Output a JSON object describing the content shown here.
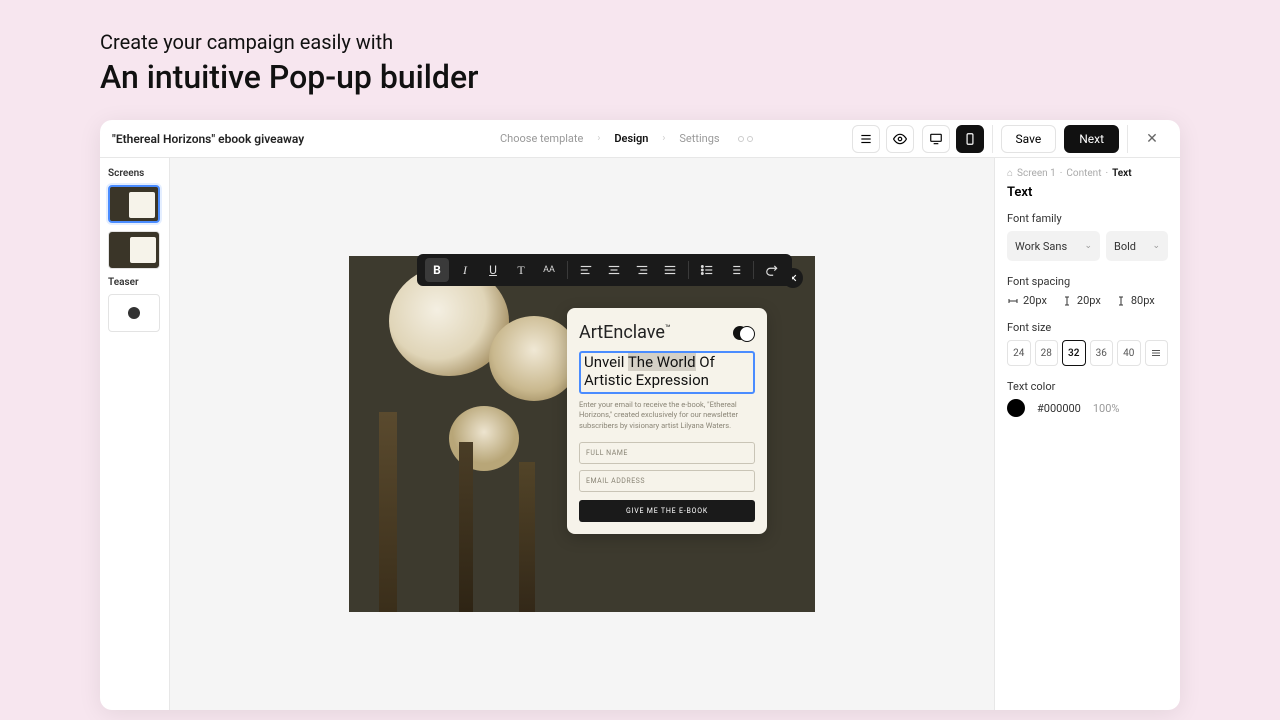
{
  "headline": {
    "small": "Create your campaign easily with",
    "large": "An intuitive Pop-up builder"
  },
  "topbar": {
    "campaign": "\"Ethereal Horizons\" ebook giveaway",
    "steps": {
      "choose": "Choose template",
      "design": "Design",
      "settings": "Settings"
    },
    "save": "Save",
    "next": "Next"
  },
  "sidebar": {
    "screens": "Screens",
    "teaser": "Teaser"
  },
  "popup": {
    "brand": "ArtEnclave",
    "heading_pre": "Unveil ",
    "heading_hl": "The World",
    "heading_post": " Of Artistic Expression",
    "desc": "Enter your email to receive the e-book, \"Ethereal Horizons,\" created exclusively for our newsletter subscribers by visionary artist Lilyana Waters.",
    "name_ph": "FULL NAME",
    "email_ph": "EMAIL ADDRESS",
    "cta": "GIVE ME THE E-BOOK"
  },
  "editbar": {
    "bold": "B",
    "italic": "I",
    "underline": "U",
    "tt": "T",
    "aa": "AA"
  },
  "panel": {
    "crumbs": {
      "s1": "Screen 1",
      "content": "Content",
      "text": "Text"
    },
    "title": "Text",
    "font_family": "Font family",
    "family_val": "Work Sans",
    "weight_val": "Bold",
    "font_spacing": "Font spacing",
    "sp1": "20px",
    "sp2": "20px",
    "sp3": "80px",
    "font_size": "Font size",
    "sizes": [
      "24",
      "28",
      "32",
      "36",
      "40"
    ],
    "text_color": "Text color",
    "hex": "#000000",
    "opacity": "100%"
  }
}
